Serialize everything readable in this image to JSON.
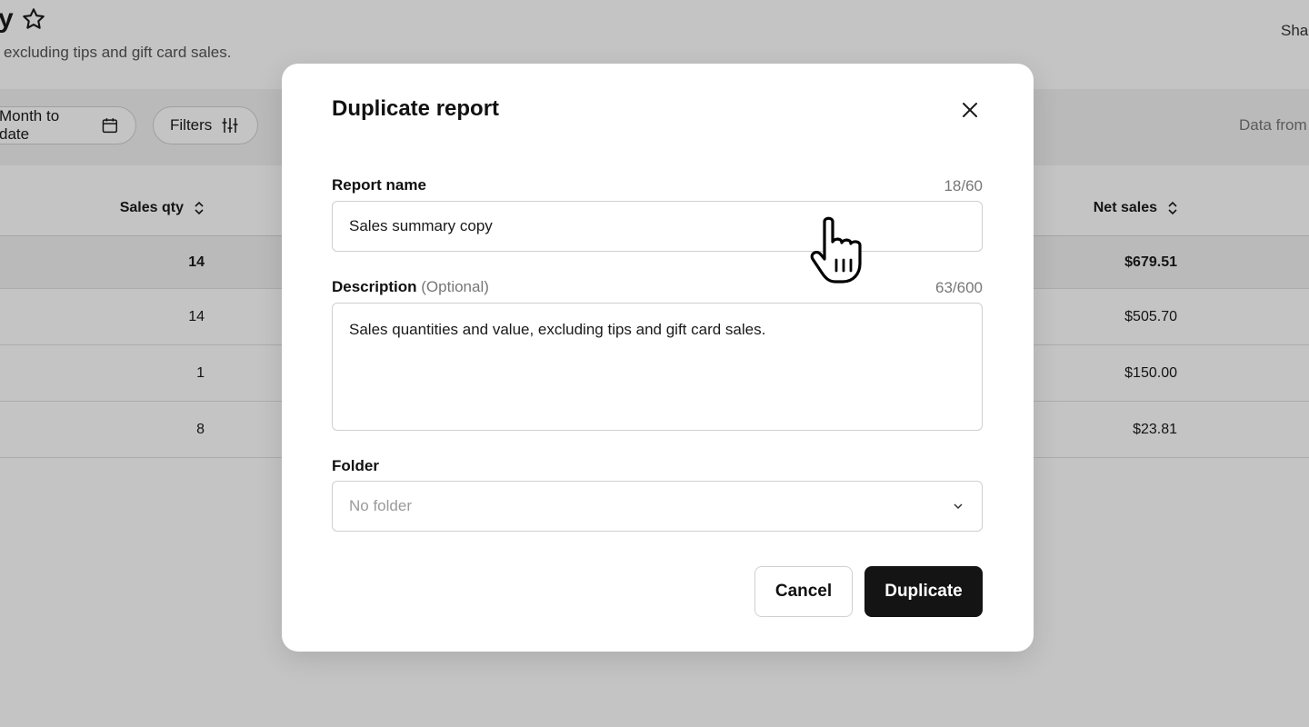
{
  "page": {
    "title_fragment": "y",
    "subtitle_fragment": "excluding tips and gift card sales.",
    "share_fragment": "Shar",
    "toolbar": {
      "date_range": "Month to date",
      "filters": "Filters",
      "data_from": "Data from"
    },
    "table": {
      "columns": [
        {
          "label": "Sales qty"
        },
        {
          "label": "Net sales"
        }
      ],
      "total": {
        "qty": "14",
        "net": "$679.51"
      },
      "rows": [
        {
          "qty": "14",
          "net": "$505.70"
        },
        {
          "qty": "1",
          "net": "$150.00"
        },
        {
          "qty": "8",
          "net": "$23.81"
        }
      ]
    }
  },
  "modal": {
    "title": "Duplicate report",
    "report_name": {
      "label": "Report name",
      "counter": "18/60",
      "value": "Sales summary copy"
    },
    "description": {
      "label": "Description",
      "optional": "(Optional)",
      "counter": "63/600",
      "value": "Sales quantities and value, excluding tips and gift card sales."
    },
    "folder": {
      "label": "Folder",
      "placeholder": "No folder"
    },
    "buttons": {
      "cancel": "Cancel",
      "duplicate": "Duplicate"
    }
  },
  "icons": {
    "star": "star-icon",
    "calendar": "calendar-icon",
    "filters": "sliders-icon",
    "sort": "sort-icon",
    "close": "close-icon",
    "chevron": "chevron-down-icon",
    "cursor": "hand-pointer-cursor-icon"
  },
  "colors": {
    "primary_button": "#141414",
    "overlay": "rgba(0,0,0,0.23)"
  }
}
